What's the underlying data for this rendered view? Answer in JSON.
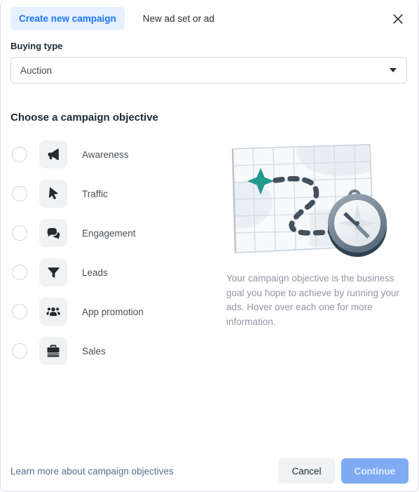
{
  "dialog": {
    "tabs": [
      {
        "label": "Create new campaign",
        "active": true,
        "name": "tab-create-new-campaign"
      },
      {
        "label": "New ad set or ad",
        "active": false,
        "name": "tab-new-ad-set-or-ad"
      }
    ],
    "close_icon": "close-icon"
  },
  "buying_type": {
    "label": "Buying type",
    "value": "Auction",
    "caret_icon": "chevron-down-icon"
  },
  "objective_section": {
    "title": "Choose a campaign objective",
    "items": [
      {
        "label": "Awareness",
        "icon": "megaphone-icon",
        "selected": false
      },
      {
        "label": "Traffic",
        "icon": "cursor-icon",
        "selected": false
      },
      {
        "label": "Engagement",
        "icon": "chat-bubble-icon",
        "selected": false
      },
      {
        "label": "Leads",
        "icon": "funnel-icon",
        "selected": false
      },
      {
        "label": "App promotion",
        "icon": "people-icon",
        "selected": false
      },
      {
        "label": "Sales",
        "icon": "briefcase-icon",
        "selected": false
      }
    ]
  },
  "info_panel": {
    "illustration": "map-with-compass-illustration",
    "description": "Your campaign objective is the business goal you hope to achieve by running your ads. Hover over each one for more information."
  },
  "footer": {
    "learn_more_label": "Learn more about campaign objectives",
    "cancel_label": "Cancel",
    "continue_label": "Continue",
    "continue_disabled": true
  },
  "colors": {
    "accent_blue": "#1877f2",
    "tab_active_bg": "#e7f0fe",
    "continue_disabled_bg": "#7fabf3",
    "cancel_bg": "#f1f2f3",
    "icon_tile_bg": "#f1f2f3",
    "text_primary": "#1c2b33",
    "text_secondary": "#4a4f54",
    "text_muted": "#9196a0",
    "link": "#5a6b8c",
    "illustration_teal": "#23998f",
    "illustration_dark": "#44505c"
  }
}
